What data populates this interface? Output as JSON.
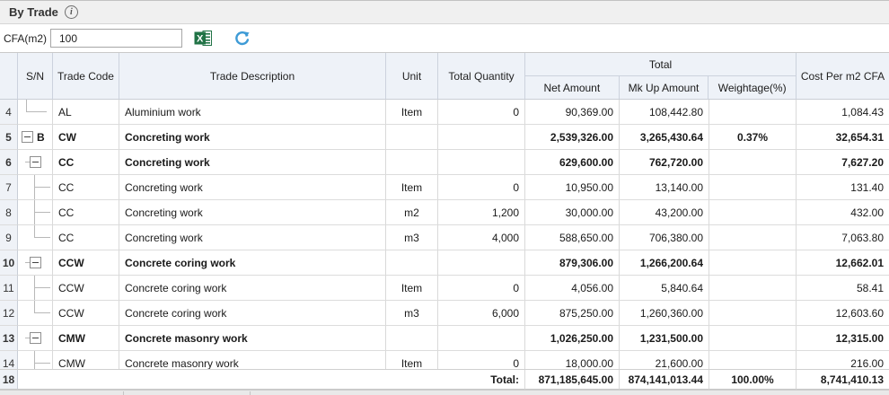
{
  "title": {
    "label": "By Trade"
  },
  "toolbar": {
    "cfa_label": "CFA(m2)",
    "cfa_value": "100",
    "excel_icon": "export-to-excel",
    "refresh_icon": "refresh",
    "excel_color": "#217346",
    "refresh_color": "#3e9bd6"
  },
  "table": {
    "columns": {
      "sn": "S/N",
      "trade_code": "Trade Code",
      "trade_description": "Trade Description",
      "unit": "Unit",
      "total_quantity": "Total Quantity",
      "total_group": "Total",
      "net_amount": "Net Amount",
      "mkup_amount": "Mk Up Amount",
      "weightage": "Weightage(%)",
      "cost_per_m2": "Cost Per m2 CFA"
    },
    "rows": [
      {
        "num": "4",
        "tree": "elbow1",
        "sn": "",
        "code": "AL",
        "desc": "Aluminium work",
        "unit": "Item",
        "qty": "0",
        "net": "90,369.00",
        "markup": "108,442.80",
        "weight": "",
        "cost": "1,084.43",
        "bold": false
      },
      {
        "num": "5",
        "tree": "box0",
        "sn": "B",
        "code": "CW",
        "desc": "Concreting work",
        "unit": "",
        "qty": "",
        "net": "2,539,326.00",
        "markup": "3,265,430.64",
        "weight": "0.37%",
        "cost": "32,654.31",
        "bold": true
      },
      {
        "num": "6",
        "tree": "box1",
        "sn": "",
        "code": "CC",
        "desc": "Concreting work",
        "unit": "",
        "qty": "",
        "net": "629,600.00",
        "markup": "762,720.00",
        "weight": "",
        "cost": "7,627.20",
        "bold": true
      },
      {
        "num": "7",
        "tree": "tee2",
        "sn": "",
        "code": "CC",
        "desc": "Concreting work",
        "unit": "Item",
        "qty": "0",
        "net": "10,950.00",
        "markup": "13,140.00",
        "weight": "",
        "cost": "131.40",
        "bold": false
      },
      {
        "num": "8",
        "tree": "tee2",
        "sn": "",
        "code": "CC",
        "desc": "Concreting work",
        "unit": "m2",
        "qty": "1,200",
        "net": "30,000.00",
        "markup": "43,200.00",
        "weight": "",
        "cost": "432.00",
        "bold": false
      },
      {
        "num": "9",
        "tree": "elbow2",
        "sn": "",
        "code": "CC",
        "desc": "Concreting work",
        "unit": "m3",
        "qty": "4,000",
        "net": "588,650.00",
        "markup": "706,380.00",
        "weight": "",
        "cost": "7,063.80",
        "bold": false
      },
      {
        "num": "10",
        "tree": "box1",
        "sn": "",
        "code": "CCW",
        "desc": "Concrete coring work",
        "unit": "",
        "qty": "",
        "net": "879,306.00",
        "markup": "1,266,200.64",
        "weight": "",
        "cost": "12,662.01",
        "bold": true
      },
      {
        "num": "11",
        "tree": "tee2",
        "sn": "",
        "code": "CCW",
        "desc": "Concrete coring work",
        "unit": "Item",
        "qty": "0",
        "net": "4,056.00",
        "markup": "5,840.64",
        "weight": "",
        "cost": "58.41",
        "bold": false
      },
      {
        "num": "12",
        "tree": "elbow2",
        "sn": "",
        "code": "CCW",
        "desc": "Concrete coring work",
        "unit": "m3",
        "qty": "6,000",
        "net": "875,250.00",
        "markup": "1,260,360.00",
        "weight": "",
        "cost": "12,603.60",
        "bold": false
      },
      {
        "num": "13",
        "tree": "box1",
        "sn": "",
        "code": "CMW",
        "desc": "Concrete masonry work",
        "unit": "",
        "qty": "",
        "net": "1,026,250.00",
        "markup": "1,231,500.00",
        "weight": "",
        "cost": "12,315.00",
        "bold": true
      },
      {
        "num": "14",
        "tree": "tee2",
        "sn": "",
        "code": "CMW",
        "desc": "Concrete masonry work",
        "unit": "Item",
        "qty": "0",
        "net": "18,000.00",
        "markup": "21,600.00",
        "weight": "",
        "cost": "216.00",
        "bold": false
      }
    ],
    "total_row": {
      "num": "18",
      "label": "Total:",
      "net": "871,185,645.00",
      "markup": "874,141,013.44",
      "weight": "100.00%",
      "cost": "8,741,410.13"
    }
  }
}
